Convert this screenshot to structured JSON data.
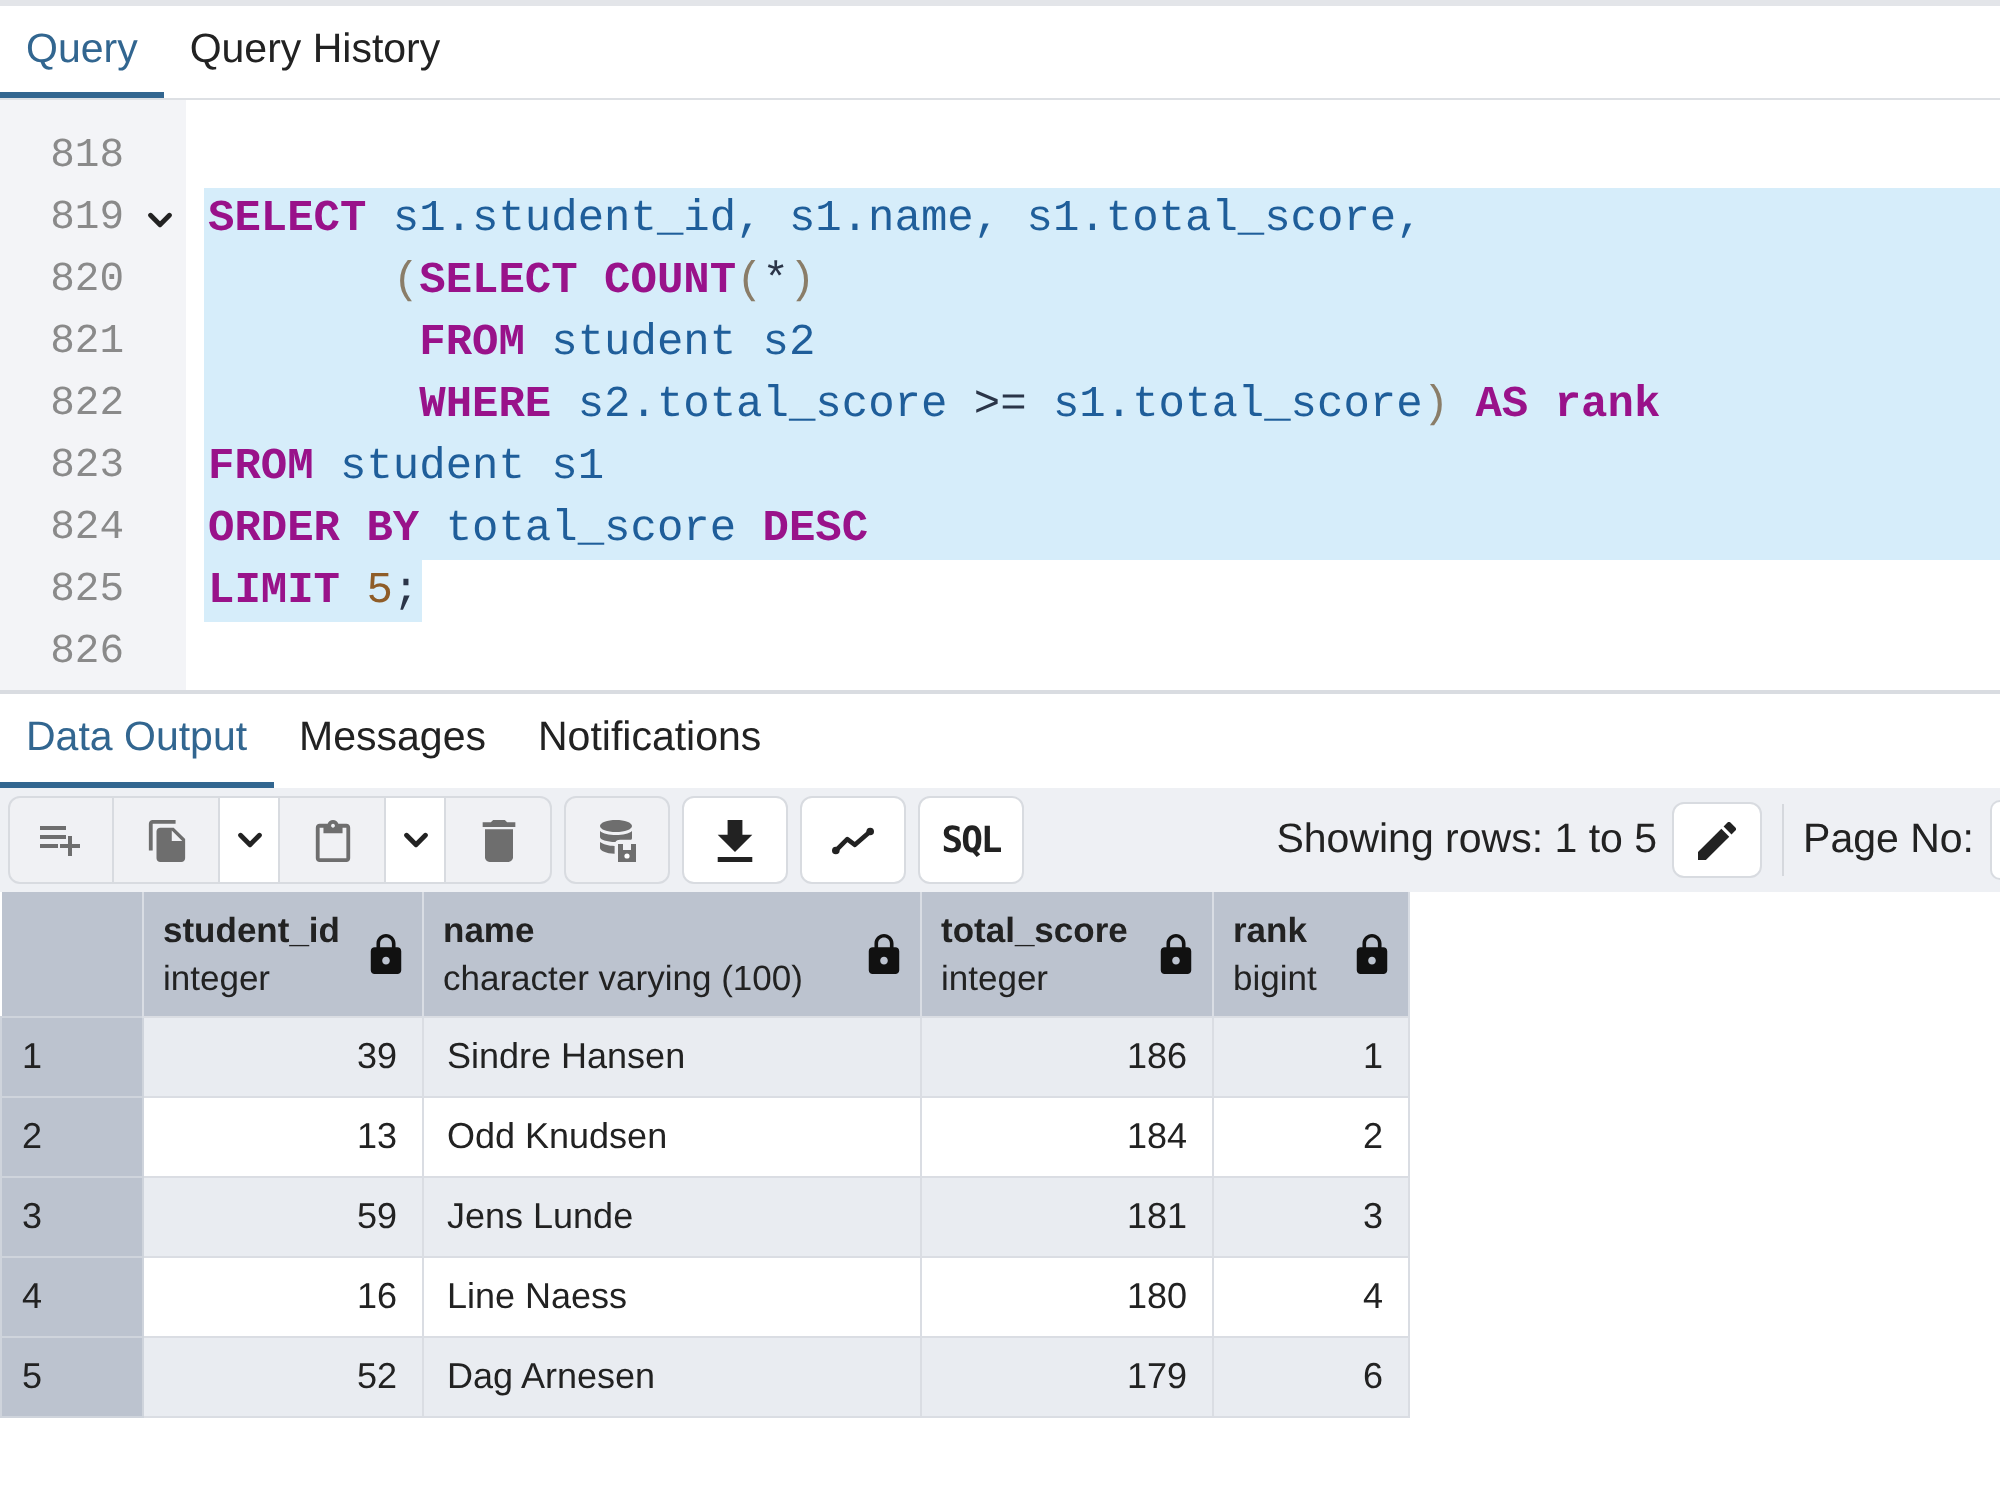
{
  "query_tabs": [
    {
      "label": "Query",
      "selected": true
    },
    {
      "label": "Query History",
      "selected": false
    }
  ],
  "editor": {
    "lines": [
      {
        "number": "818",
        "foldable": false,
        "selected": false
      },
      {
        "number": "819",
        "foldable": true,
        "selected": true,
        "tokens": [
          {
            "kind": "keyword",
            "text": "SELECT"
          },
          {
            "kind": "identifier",
            "text": " s1.student_id, s1.name, s1.total_score,"
          }
        ]
      },
      {
        "number": "820",
        "foldable": false,
        "selected": true,
        "tokens": [
          {
            "kind": "bracket",
            "text": "       ("
          },
          {
            "kind": "keyword",
            "text": "SELECT COUNT"
          },
          {
            "kind": "bracket",
            "text": "("
          },
          {
            "kind": "operator",
            "text": "*"
          },
          {
            "kind": "bracket",
            "text": ")"
          }
        ]
      },
      {
        "number": "821",
        "foldable": false,
        "selected": true,
        "tokens": [
          {
            "kind": "keyword",
            "text": "        FROM"
          },
          {
            "kind": "identifier",
            "text": " student s2"
          }
        ]
      },
      {
        "number": "822",
        "foldable": false,
        "selected": true,
        "tokens": [
          {
            "kind": "keyword",
            "text": "        WHERE"
          },
          {
            "kind": "identifier",
            "text": " s2.total_score "
          },
          {
            "kind": "operator",
            "text": ">="
          },
          {
            "kind": "identifier",
            "text": " s1.total_score"
          },
          {
            "kind": "bracket",
            "text": ")"
          },
          {
            "kind": "keyword",
            "text": " AS rank"
          }
        ]
      },
      {
        "number": "823",
        "foldable": false,
        "selected": true,
        "tokens": [
          {
            "kind": "keyword",
            "text": "FROM"
          },
          {
            "kind": "identifier",
            "text": " student s1"
          }
        ]
      },
      {
        "number": "824",
        "foldable": false,
        "selected": true,
        "tokens": [
          {
            "kind": "keyword",
            "text": "ORDER BY"
          },
          {
            "kind": "identifier",
            "text": " total_score "
          },
          {
            "kind": "keyword",
            "text": "DESC"
          }
        ]
      },
      {
        "number": "825",
        "foldable": false,
        "selected": true,
        "tokens": [
          {
            "kind": "keyword",
            "text": "LIMIT"
          },
          {
            "kind": "number",
            "text": " 5"
          },
          {
            "kind": "operator",
            "text": ";"
          }
        ]
      },
      {
        "number": "826",
        "foldable": false,
        "selected": false
      }
    ]
  },
  "result_tabs": [
    {
      "label": "Data Output",
      "selected": true
    },
    {
      "label": "Messages",
      "selected": false
    },
    {
      "label": "Notifications",
      "selected": false
    }
  ],
  "toolbar": {
    "groups": [
      {
        "buttons": [
          {
            "kind": "icon",
            "disabled": true
          },
          {
            "kind": "icon",
            "disabled": true
          },
          {
            "kind": "menu",
            "disabled": false
          },
          {
            "kind": "icon",
            "disabled": true
          },
          {
            "kind": "menu",
            "disabled": false
          },
          {
            "kind": "icon",
            "disabled": true
          }
        ]
      },
      {
        "buttons": [
          {
            "kind": "icon",
            "disabled": true
          }
        ]
      },
      {
        "buttons": [
          {
            "kind": "icon",
            "disabled": false
          }
        ]
      },
      {
        "buttons": [
          {
            "kind": "icon",
            "disabled": false
          }
        ]
      },
      {
        "buttons": [
          {
            "kind": "text",
            "label": "SQL",
            "disabled": false
          }
        ]
      }
    ],
    "row_count": "Showing rows: 1 to 5",
    "edit_button": {
      "disabled": false
    },
    "page_label": "Page No:"
  },
  "table": {
    "columns": [
      {
        "name": "student_id",
        "type": "integer",
        "right_aligned": true,
        "read_only": true
      },
      {
        "name": "name",
        "type": "character varying (100)",
        "right_aligned": false,
        "read_only": true
      },
      {
        "name": "total_score",
        "type": "integer",
        "right_aligned": true,
        "read_only": true
      },
      {
        "name": "rank",
        "type": "bigint",
        "right_aligned": true,
        "read_only": true
      }
    ],
    "rows": [
      {
        "number": "1",
        "cells": [
          "39",
          "Sindre Hansen",
          "186",
          "1"
        ]
      },
      {
        "number": "2",
        "cells": [
          "13",
          "Odd Knudsen",
          "184",
          "2"
        ]
      },
      {
        "number": "3",
        "cells": [
          "59",
          "Jens Lunde",
          "181",
          "3"
        ]
      },
      {
        "number": "4",
        "cells": [
          "16",
          "Line Naess",
          "180",
          "4"
        ]
      },
      {
        "number": "5",
        "cells": [
          "52",
          "Dag Arnesen",
          "179",
          "6"
        ]
      }
    ]
  }
}
